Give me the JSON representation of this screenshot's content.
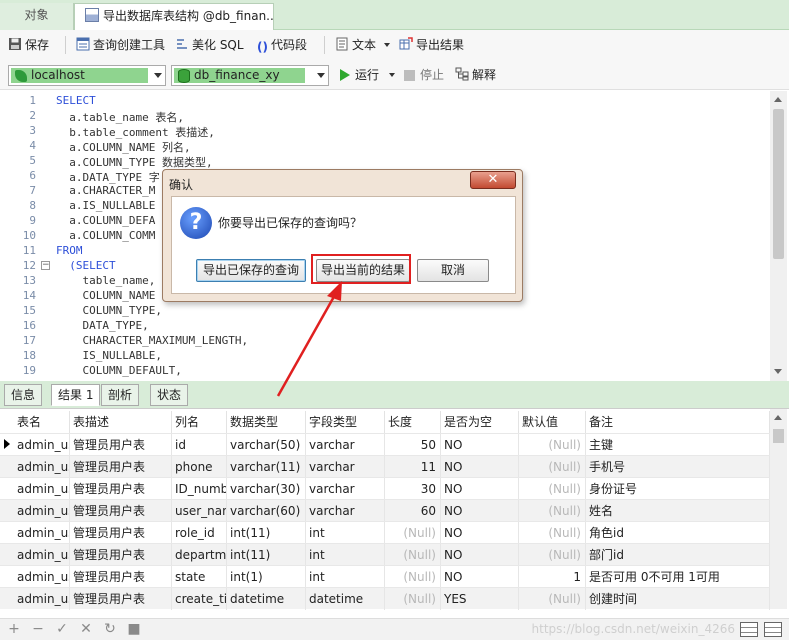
{
  "tabs": {
    "objects": "对象",
    "query": "导出数据库表结构 @db_finan..."
  },
  "toolbar": {
    "save": "保存",
    "query_builder": "查询创建工具",
    "beautify": "美化 SQL",
    "snippet": "代码段",
    "text": "文本",
    "export": "导出结果"
  },
  "connection": {
    "host": "localhost",
    "database": "db_finance_xy",
    "run": "运行",
    "stop": "停止",
    "explain": "解释"
  },
  "editor": {
    "line_numbers": [
      "1",
      "2",
      "3",
      "4",
      "5",
      "6",
      "7",
      "8",
      "9",
      "10",
      "11",
      "12",
      "13",
      "14",
      "15",
      "16",
      "17",
      "18",
      "19"
    ],
    "lines": [
      {
        "indent": "",
        "kw": "SELECT",
        "text": ""
      },
      {
        "indent": "  ",
        "kw": "",
        "text": "a.table_name 表名,"
      },
      {
        "indent": "  ",
        "kw": "",
        "text": "b.table_comment 表描述,"
      },
      {
        "indent": "  ",
        "kw": "",
        "text": "a.COLUMN_NAME 列名,"
      },
      {
        "indent": "  ",
        "kw": "",
        "text": "a.COLUMN_TYPE 数据类型,"
      },
      {
        "indent": "  ",
        "kw": "",
        "text": "a.DATA_TYPE 字"
      },
      {
        "indent": "  ",
        "kw": "",
        "text": "a.CHARACTER_M"
      },
      {
        "indent": "  ",
        "kw": "",
        "text": "a.IS_NULLABLE"
      },
      {
        "indent": "  ",
        "kw": "",
        "text": "a.COLUMN_DEFA"
      },
      {
        "indent": "  ",
        "kw": "",
        "text": "a.COLUMN_COMM"
      },
      {
        "indent": "",
        "kw": "FROM",
        "text": ""
      },
      {
        "indent": "  ",
        "kw": "(SELECT",
        "text": ""
      },
      {
        "indent": "    ",
        "kw": "",
        "text": "table_name,"
      },
      {
        "indent": "    ",
        "kw": "",
        "text": "COLUMN_NAME"
      },
      {
        "indent": "    ",
        "kw": "",
        "text": "COLUMN_TYPE,"
      },
      {
        "indent": "    ",
        "kw": "",
        "text": "DATA_TYPE,"
      },
      {
        "indent": "    ",
        "kw": "",
        "text": "CHARACTER_MAXIMUM_LENGTH,"
      },
      {
        "indent": "    ",
        "kw": "",
        "text": "IS_NULLABLE,"
      },
      {
        "indent": "    ",
        "kw": "",
        "text": "COLUMN_DEFAULT,"
      }
    ]
  },
  "result_tabs": [
    "信息",
    "结果 1",
    "剖析",
    "状态"
  ],
  "grid": {
    "headers": [
      "表名",
      "表描述",
      "列名",
      "数据类型",
      "字段类型",
      "长度",
      "是否为空",
      "默认值",
      "备注"
    ],
    "rows": [
      [
        "admin_us",
        "管理员用户表",
        "id",
        "varchar(50)",
        "varchar",
        "50",
        "NO",
        "(Null)",
        "主键"
      ],
      [
        "admin_us",
        "管理员用户表",
        "phone",
        "varchar(11)",
        "varchar",
        "11",
        "NO",
        "(Null)",
        "手机号"
      ],
      [
        "admin_us",
        "管理员用户表",
        "ID_numb",
        "varchar(30)",
        "varchar",
        "30",
        "NO",
        "(Null)",
        "身份证号"
      ],
      [
        "admin_us",
        "管理员用户表",
        "user_nan",
        "varchar(60)",
        "varchar",
        "60",
        "NO",
        "(Null)",
        "姓名"
      ],
      [
        "admin_us",
        "管理员用户表",
        "role_id",
        "int(11)",
        "int",
        "(Null)",
        "NO",
        "(Null)",
        "角色id"
      ],
      [
        "admin_us",
        "管理员用户表",
        "departm",
        "int(11)",
        "int",
        "(Null)",
        "NO",
        "(Null)",
        "部门id"
      ],
      [
        "admin_us",
        "管理员用户表",
        "state",
        "int(1)",
        "int",
        "(Null)",
        "NO",
        "1",
        "是否可用 0不可用 1可用"
      ],
      [
        "admin_us",
        "管理员用户表",
        "create_tir",
        "datetime",
        "datetime",
        "(Null)",
        "YES",
        "(Null)",
        "创建时间"
      ]
    ]
  },
  "dialog": {
    "title": "确认",
    "message": "你要导出已保存的查询吗？",
    "btn_saved": "导出已保存的查询",
    "btn_current": "导出当前的结果",
    "btn_cancel": "取消",
    "close": "✕"
  },
  "watermark": "https://blog.csdn.net/weixin_4266"
}
